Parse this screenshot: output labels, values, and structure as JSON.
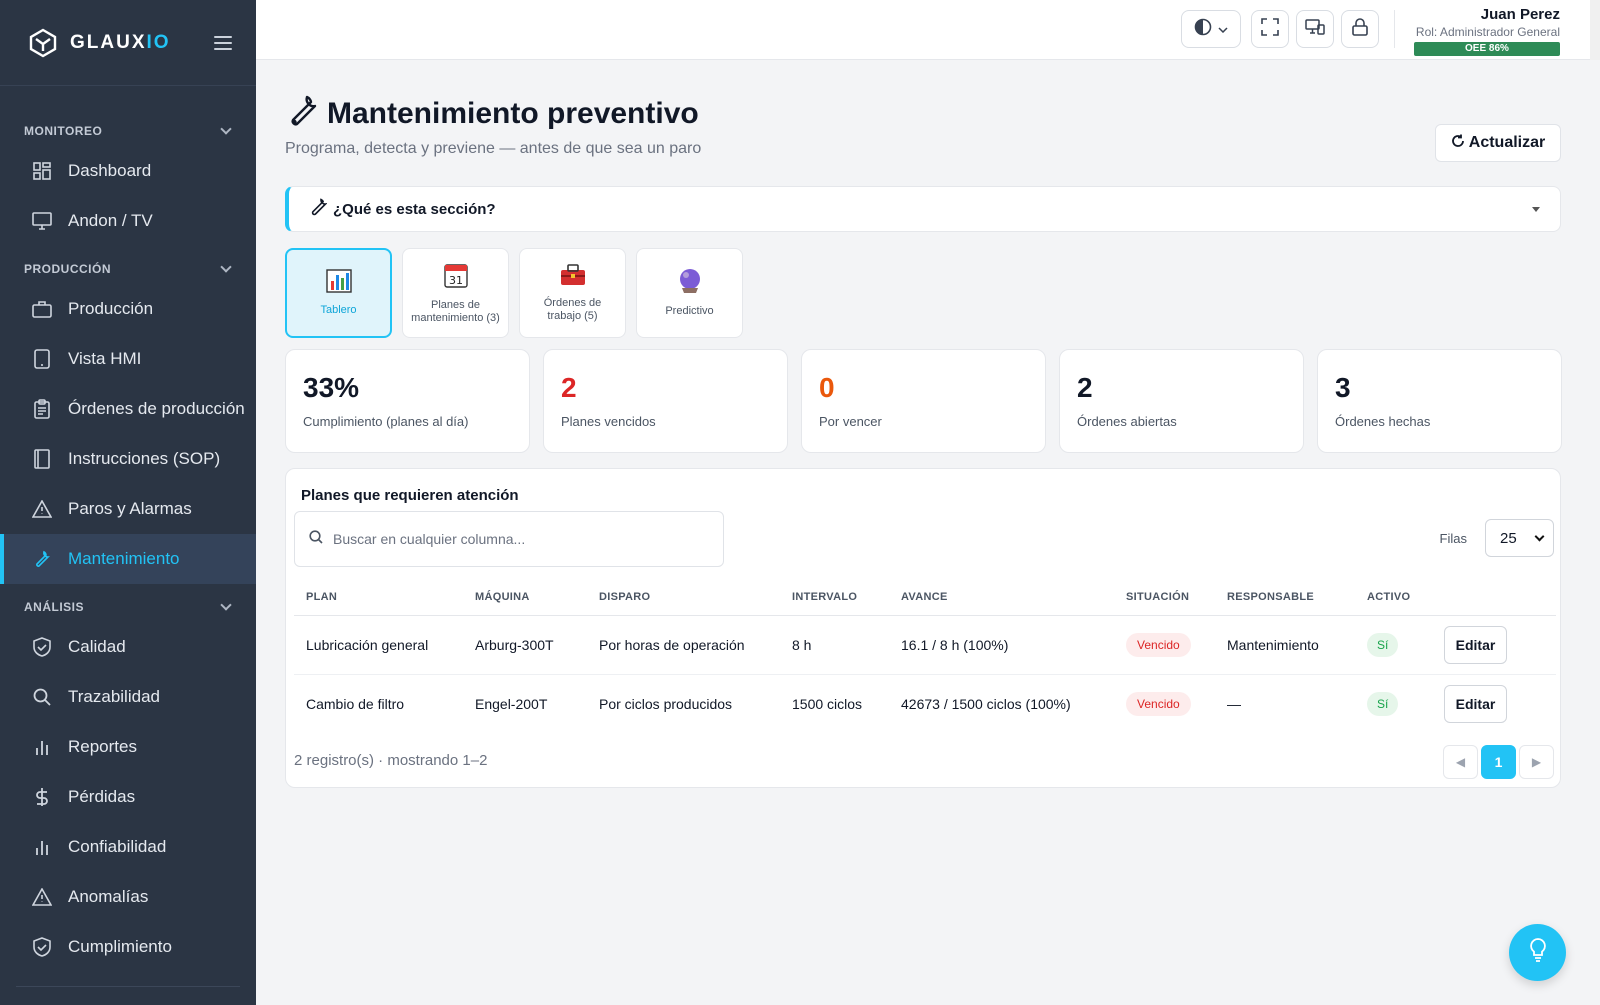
{
  "brand": {
    "name_main": "GLAUX",
    "name_accent": "IO"
  },
  "sidebar": {
    "sections": [
      {
        "title": "MONITOREO",
        "items": [
          {
            "label": "Dashboard",
            "icon": "grid-icon"
          },
          {
            "label": "Andon / TV",
            "icon": "monitor-icon"
          }
        ]
      },
      {
        "title": "PRODUCCIÓN",
        "items": [
          {
            "label": "Producción",
            "icon": "briefcase-icon"
          },
          {
            "label": "Vista HMI",
            "icon": "tablet-icon"
          },
          {
            "label": "Órdenes de producción",
            "icon": "clipboard-icon"
          },
          {
            "label": "Instrucciones (SOP)",
            "icon": "book-icon"
          },
          {
            "label": "Paros y Alarmas",
            "icon": "alert-triangle-icon"
          },
          {
            "label": "Mantenimiento",
            "icon": "wrench-icon",
            "active": true
          }
        ]
      },
      {
        "title": "ANÁLISIS",
        "items": [
          {
            "label": "Calidad",
            "icon": "shield-check-icon"
          },
          {
            "label": "Trazabilidad",
            "icon": "search-icon"
          },
          {
            "label": "Reportes",
            "icon": "bar-chart-icon"
          },
          {
            "label": "Pérdidas",
            "icon": "dollar-icon"
          },
          {
            "label": "Confiabilidad",
            "icon": "bar-chart-icon"
          },
          {
            "label": "Anomalías",
            "icon": "alert-triangle-icon"
          },
          {
            "label": "Cumplimiento",
            "icon": "shield-check-icon"
          }
        ]
      }
    ]
  },
  "topbar": {
    "user_name": "Juan Perez",
    "user_role": "Rol: Administrador General",
    "oee": "OEE 86%"
  },
  "page": {
    "title": "Mantenimiento preventivo",
    "subtitle": "Programa, detecta y previene — antes de que sea un paro",
    "refresh_label": "Actualizar",
    "info_label": "¿Qué es esta sección?"
  },
  "tabs": [
    {
      "label": "Tablero",
      "icon": "bar-chart-emoji-icon",
      "active": true
    },
    {
      "label": "Planes de mantenimiento (3)",
      "icon": "calendar-icon"
    },
    {
      "label": "Órdenes de trabajo (5)",
      "icon": "toolbox-icon"
    },
    {
      "label": "Predictivo",
      "icon": "crystal-ball-icon"
    }
  ],
  "kpis": [
    {
      "value": "33%",
      "label": "Cumplimiento (planes al día)",
      "color": "#111827"
    },
    {
      "value": "2",
      "label": "Planes vencidos",
      "color": "#dc2626"
    },
    {
      "value": "0",
      "label": "Por vencer",
      "color": "#ea580c"
    },
    {
      "value": "2",
      "label": "Órdenes abiertas",
      "color": "#111827"
    },
    {
      "value": "3",
      "label": "Órdenes hechas",
      "color": "#111827"
    }
  ],
  "table": {
    "title": "Planes que requieren atención",
    "search_placeholder": "Buscar en cualquier columna...",
    "rows_label": "Filas",
    "rows_value": "25",
    "columns": [
      "PLAN",
      "MÁQUINA",
      "DISPARO",
      "INTERVALO",
      "AVANCE",
      "SITUACIÓN",
      "RESPONSABLE",
      "ACTIVO",
      ""
    ],
    "rows": [
      {
        "plan": "Lubricación general",
        "maquina": "Arburg-300T",
        "disparo": "Por horas de operación",
        "intervalo": "8 h",
        "avance": "16.1 / 8 h (100%)",
        "situacion": "Vencido",
        "responsable": "Mantenimiento",
        "activo": "Sí",
        "action": "Editar"
      },
      {
        "plan": "Cambio de filtro",
        "maquina": "Engel-200T",
        "disparo": "Por ciclos producidos",
        "intervalo": "1500 ciclos",
        "avance": "42673 / 1500 ciclos (100%)",
        "situacion": "Vencido",
        "responsable": "—",
        "activo": "Sí",
        "action": "Editar"
      }
    ],
    "footer": "2 registro(s) · mostrando 1–2",
    "current_page": "1"
  },
  "colors": {
    "accent": "#22c3f5",
    "sidebar_bg": "#2b3544",
    "danger": "#dc2626",
    "warning": "#ea580c",
    "success": "#16a34a"
  }
}
